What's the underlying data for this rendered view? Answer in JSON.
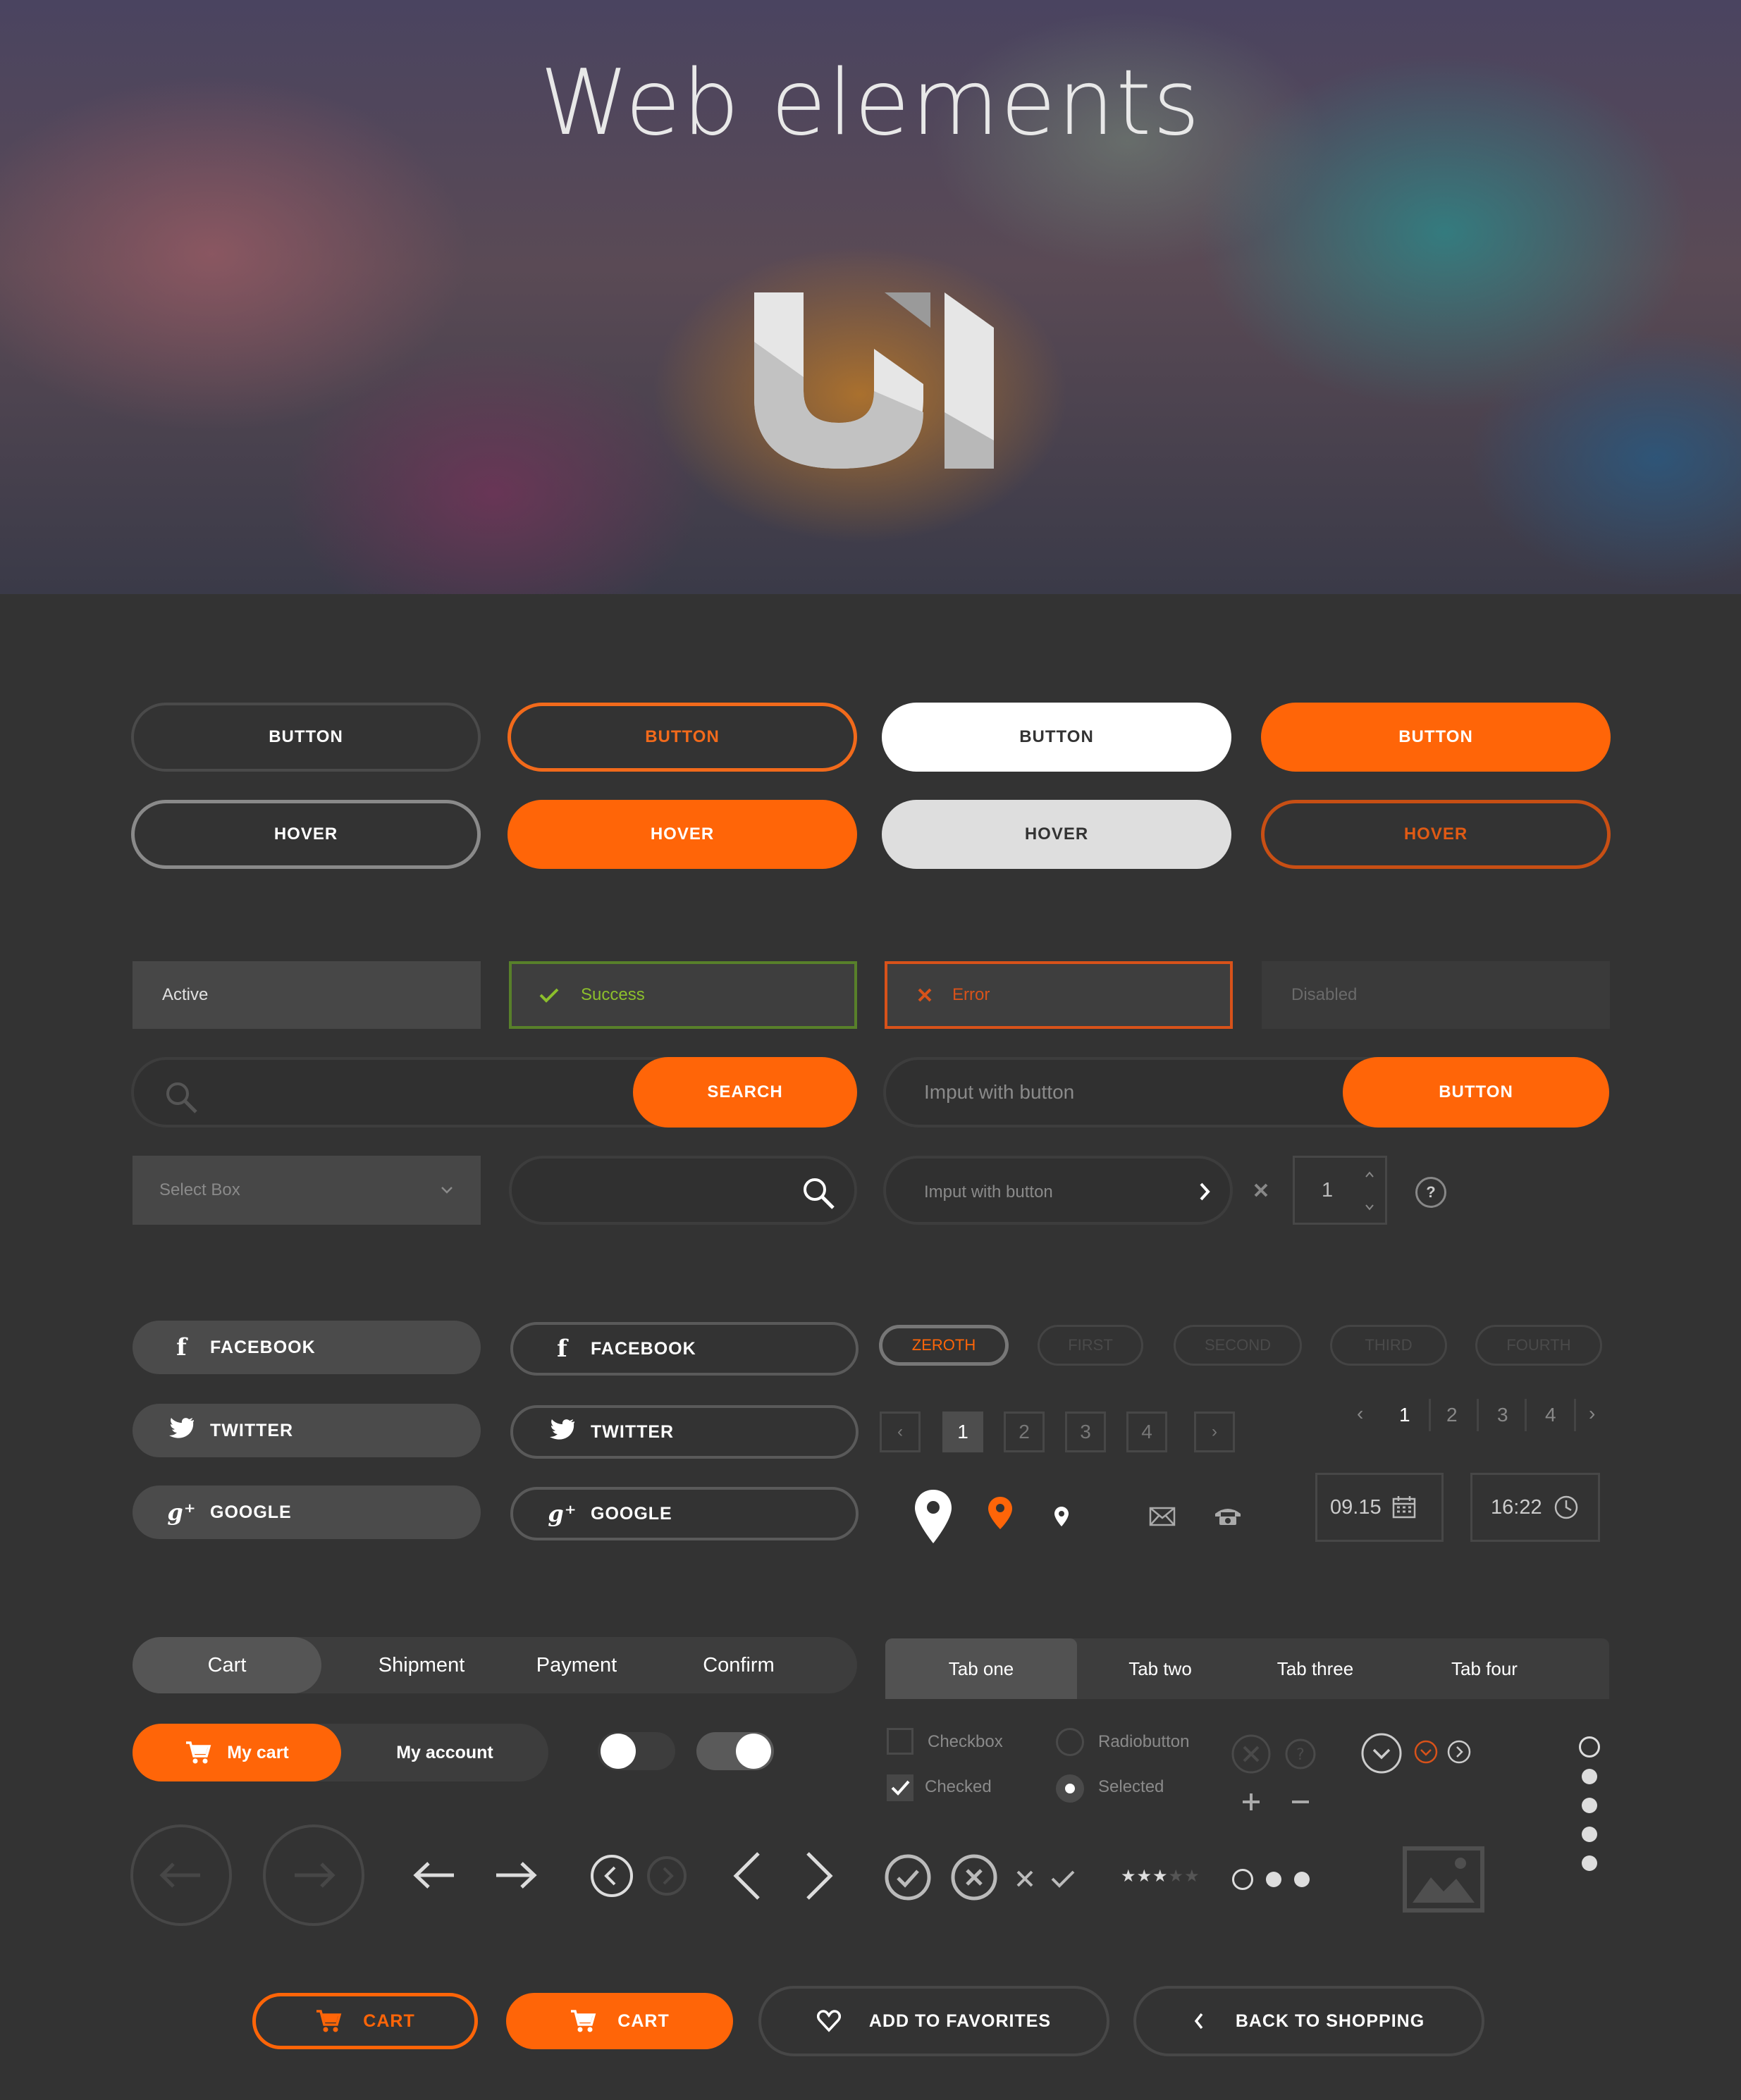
{
  "hero": {
    "title": "Web elements",
    "logo_text": "UI"
  },
  "buttons": {
    "row1": [
      "BUTTON",
      "BUTTON",
      "BUTTON",
      "BUTTON"
    ],
    "row2": [
      "HOVER",
      "HOVER",
      "HOVER",
      "HOVER"
    ]
  },
  "fields": {
    "active": "Active",
    "success": "Success",
    "error": "Error",
    "disabled": "Disabled"
  },
  "search": {
    "button": "SEARCH"
  },
  "input_button": {
    "placeholder": "Imput with button",
    "button": "BUTTON"
  },
  "select_box": {
    "label": "Select Box"
  },
  "input_arrow": {
    "placeholder": "Imput with button"
  },
  "spinner": {
    "value": "1"
  },
  "help": "?",
  "social_filled": [
    "FACEBOOK",
    "TWITTER",
    "GOOGLE"
  ],
  "social_outline": [
    "FACEBOOK",
    "TWITTER",
    "GOOGLE"
  ],
  "steps": [
    "ZEROTH",
    "FIRST",
    "SECOND",
    "THIRD",
    "FOURTH"
  ],
  "pager_boxed": {
    "prev": "‹",
    "next": "›",
    "pages": [
      "1",
      "2",
      "3",
      "4"
    ]
  },
  "pager_plain": {
    "prev": "‹",
    "next": "›",
    "pages": [
      "1",
      "2",
      "3",
      "4"
    ]
  },
  "date": "09.15",
  "time": "16:22",
  "checkout_tabs": [
    "Cart",
    "Shipment",
    "Payment",
    "Confirm"
  ],
  "tabs": [
    "Tab one",
    "Tab two",
    "Tab three",
    "Tab four"
  ],
  "account_switch": {
    "cart": "My cart",
    "account": "My account"
  },
  "checks": {
    "checkbox": "Checkbox",
    "checked": "Checked",
    "radio": "Radiobutton",
    "selected": "Selected"
  },
  "rating": {
    "value": 3,
    "max": 5
  },
  "bottom": {
    "cart1": "CART",
    "cart2": "CART",
    "favorites": "ADD TO FAVORITES",
    "back": "BACK TO SHOPPING"
  },
  "colors": {
    "accent": "#ff6508",
    "background": "#333333",
    "success": "#8cbf2c",
    "error": "#d8521a"
  }
}
